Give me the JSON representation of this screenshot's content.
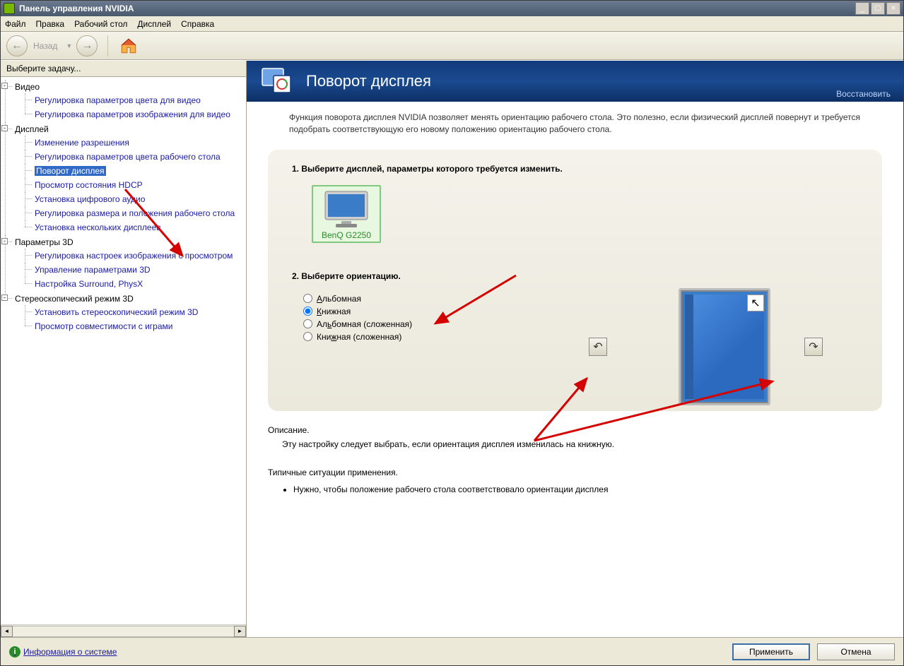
{
  "window": {
    "title": "Панель управления NVIDIA"
  },
  "menubar": {
    "items": [
      "Файл",
      "Правка",
      "Рабочий стол",
      "Дисплей",
      "Справка"
    ]
  },
  "toolbar": {
    "back_label": "Назад"
  },
  "sidebar": {
    "header": "Выберите задачу...",
    "groups": [
      {
        "label": "Видео",
        "items": [
          "Регулировка параметров цвета для видео",
          "Регулировка параметров изображения для видео"
        ]
      },
      {
        "label": "Дисплей",
        "items": [
          "Изменение разрешения",
          "Регулировка параметров цвета рабочего стола",
          "Поворот дисплея",
          "Просмотр состояния HDCP",
          "Установка цифрового аудио",
          "Регулировка размера и положения рабочего стола",
          "Установка нескольких дисплеев"
        ],
        "selected": 2
      },
      {
        "label": "Параметры 3D",
        "items": [
          "Регулировка настроек изображения с просмотром",
          "Управление параметрами 3D",
          "Настройка Surround, PhysX"
        ]
      },
      {
        "label": "Стереоскопический режим 3D",
        "items": [
          "Установить стереоскопический режим 3D",
          "Просмотр совместимости с играми"
        ]
      }
    ]
  },
  "content": {
    "header_title": "Поворот дисплея",
    "restore_link": "Восстановить",
    "intro": "Функция поворота дисплея NVIDIA позволяет менять ориентацию рабочего стола. Это полезно, если физический дисплей повернут и требуется подобрать соответствующую его новому положению ориентацию рабочего стола.",
    "step1_title": "1. Выберите дисплей, параметры которого требуется изменить.",
    "display_name": "BenQ G2250",
    "step2_title": "2. Выберите ориентацию.",
    "orientations": [
      {
        "text": "Альбомная",
        "u": 0,
        "checked": false
      },
      {
        "text": "Книжная",
        "u": 0,
        "checked": true
      },
      {
        "text": "Альбомная (сложенная)",
        "u": 2,
        "checked": false
      },
      {
        "text": "Книжная (сложенная)",
        "u": 3,
        "checked": false
      }
    ],
    "desc_label": "Описание.",
    "desc_text": "Эту настройку следует выбрать, если ориентация дисплея изменилась на книжную.",
    "usage_label": "Типичные ситуации применения.",
    "usage_items": [
      "Нужно, чтобы положение рабочего стола соответствовало ориентации дисплея"
    ]
  },
  "footer": {
    "info_link": "Информация о системе",
    "apply": "Применить",
    "cancel": "Отмена"
  }
}
